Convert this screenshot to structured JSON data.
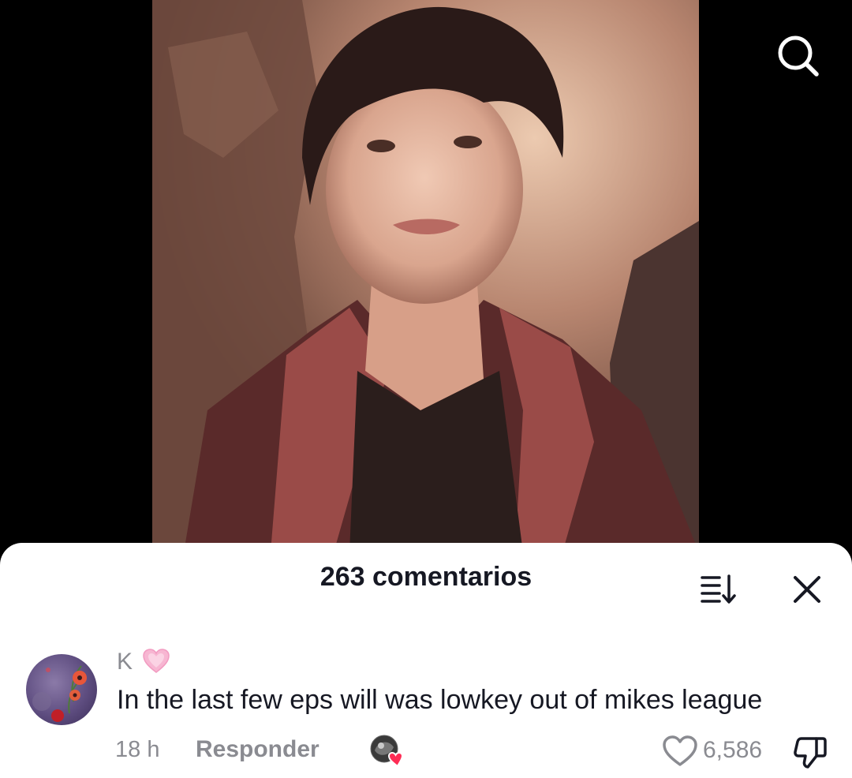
{
  "comments_sheet": {
    "title": "263 comentarios",
    "sort_icon": "sort-icon",
    "close_icon": "close-icon"
  },
  "header": {
    "search_icon": "search-icon"
  },
  "comment": {
    "username": "K",
    "badge_icon": "pink-heart-icon",
    "text": "In the last few eps will was lowkey out of mikes league",
    "time": "18 h",
    "reply_label": "Responder",
    "like_count": "6,586",
    "like_icon": "heart-outline-icon",
    "dislike_icon": "thumbs-down-icon"
  },
  "colors": {
    "text_primary": "#161823",
    "text_secondary": "#8a8b91",
    "heart_pink": "#fe2c55"
  }
}
